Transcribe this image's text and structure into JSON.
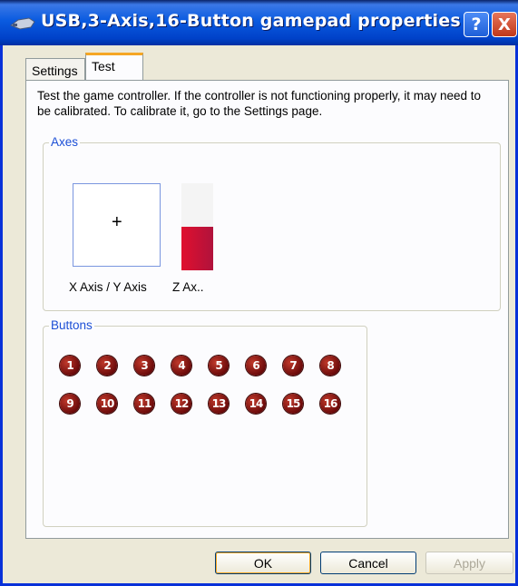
{
  "window": {
    "title": "USB,3-Axis,16-Button gamepad properties",
    "help_label": "?",
    "close_label": "X"
  },
  "tabs": [
    {
      "label": "Settings",
      "active": false
    },
    {
      "label": "Test",
      "active": true
    }
  ],
  "description": "Test the game controller.  If the controller is not functioning properly, it may need to be calibrated.  To calibrate it, go to the Settings page.",
  "axes": {
    "legend": "Axes",
    "xy_label": "X Axis / Y Axis",
    "crosshair": "+",
    "z_label": "Z Ax..",
    "z_level_fraction": 0.5,
    "z_color": "#d6102e"
  },
  "buttons_group": {
    "legend": "Buttons",
    "buttons": [
      "1",
      "2",
      "3",
      "4",
      "5",
      "6",
      "7",
      "8",
      "9",
      "10",
      "11",
      "12",
      "13",
      "14",
      "15",
      "16"
    ],
    "button_color": "#7a0c0c"
  },
  "footer": {
    "ok": "OK",
    "cancel": "Cancel",
    "apply": "Apply"
  }
}
